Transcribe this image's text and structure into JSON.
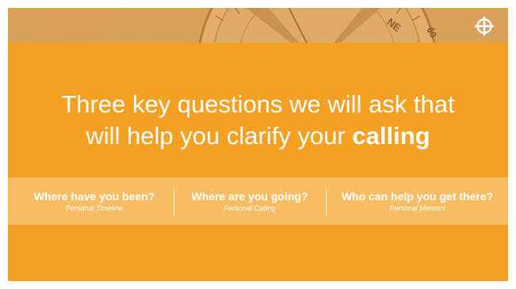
{
  "slide": {
    "headline_line1": "Three key questions we will ask that",
    "headline_line2_pre": "will help you clarify your ",
    "headline_emphasis": "calling",
    "questions": [
      {
        "title": "Where have you been?",
        "subtitle": "Personal Timeline"
      },
      {
        "title": "Where are you going?",
        "subtitle": "Personal Calling"
      },
      {
        "title": "Who can help you get there?",
        "subtitle": "Personal Mentors"
      }
    ],
    "compass_labels": {
      "ne": "NE",
      "sixty": "60"
    },
    "colors": {
      "background": "#f4a023",
      "band": "#f8bc62",
      "text": "#ffffff"
    },
    "icons": {
      "logo": "compass-crosshair-icon",
      "header_image": "compass-image"
    }
  }
}
